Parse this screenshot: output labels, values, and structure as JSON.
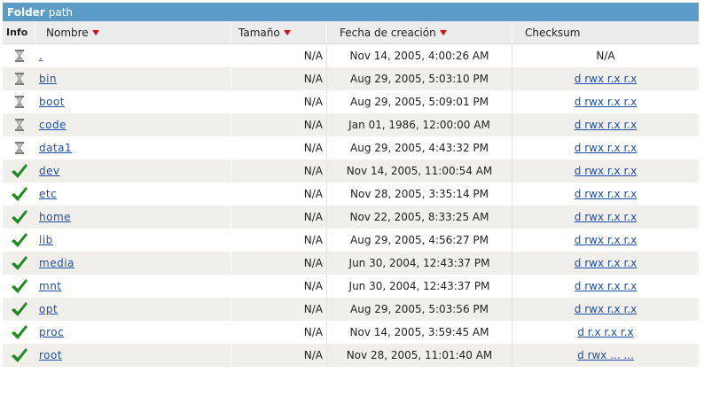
{
  "title": {
    "strong": "Folder",
    "path": "path"
  },
  "columns": {
    "info": "Info",
    "name": "Nombre",
    "size": "Tamaño",
    "date": "Fecha de creación",
    "checksum": "Checksum"
  },
  "colors": {
    "titlebar": "#5a9cc6",
    "sort_arrow": "#d01010",
    "link": "#1f4fa8",
    "check": "#1f8a1f"
  },
  "rows": [
    {
      "status": "hourglass-icon",
      "name": ".",
      "size": "N/A",
      "date": "Nov 14, 2005, 4:00:26 AM",
      "checksum": "N/A",
      "checksum_link": false
    },
    {
      "status": "hourglass-icon",
      "name": "bin",
      "size": "N/A",
      "date": "Aug 29, 2005, 5:03:10 PM",
      "checksum": "d rwx r.x r.x",
      "checksum_link": true
    },
    {
      "status": "hourglass-icon",
      "name": "boot",
      "size": "N/A",
      "date": "Aug 29, 2005, 5:09:01 PM",
      "checksum": "d rwx r.x r.x",
      "checksum_link": true
    },
    {
      "status": "hourglass-icon",
      "name": "code",
      "size": "N/A",
      "date": "Jan 01, 1986, 12:00:00 AM",
      "checksum": "d rwx r.x r.x",
      "checksum_link": true
    },
    {
      "status": "hourglass-icon",
      "name": "data1",
      "size": "N/A",
      "date": "Aug 29, 2005, 4:43:32 PM",
      "checksum": "d rwx r.x r.x",
      "checksum_link": true
    },
    {
      "status": "checkmark-icon",
      "name": "dev",
      "size": "N/A",
      "date": "Nov 14, 2005, 11:00:54 AM",
      "checksum": "d rwx r.x r.x",
      "checksum_link": true
    },
    {
      "status": "checkmark-icon",
      "name": "etc",
      "size": "N/A",
      "date": "Nov 28, 2005, 3:35:14 PM",
      "checksum": "d rwx r.x r.x",
      "checksum_link": true
    },
    {
      "status": "checkmark-icon",
      "name": "home",
      "size": "N/A",
      "date": "Nov 22, 2005, 8:33:25 AM",
      "checksum": "d rwx r.x r.x",
      "checksum_link": true
    },
    {
      "status": "checkmark-icon",
      "name": "lib",
      "size": "N/A",
      "date": "Aug 29, 2005, 4:56:27 PM",
      "checksum": "d rwx r.x r.x",
      "checksum_link": true
    },
    {
      "status": "checkmark-icon",
      "name": "media",
      "size": "N/A",
      "date": "Jun 30, 2004, 12:43:37 PM",
      "checksum": "d rwx r.x r.x",
      "checksum_link": true
    },
    {
      "status": "checkmark-icon",
      "name": "mnt",
      "size": "N/A",
      "date": "Jun 30, 2004, 12:43:37 PM",
      "checksum": "d rwx r.x r.x",
      "checksum_link": true
    },
    {
      "status": "checkmark-icon",
      "name": "opt",
      "size": "N/A",
      "date": "Aug 29, 2005, 5:03:56 PM",
      "checksum": "d rwx r.x r.x",
      "checksum_link": true
    },
    {
      "status": "checkmark-icon",
      "name": "proc",
      "size": "N/A",
      "date": "Nov 14, 2005, 3:59:45 AM",
      "checksum": "d r.x r.x r.x",
      "checksum_link": true
    },
    {
      "status": "checkmark-icon",
      "name": "root",
      "size": "N/A",
      "date": "Nov 28, 2005, 11:01:40 AM",
      "checksum": "d rwx ... ...",
      "checksum_link": true
    }
  ]
}
